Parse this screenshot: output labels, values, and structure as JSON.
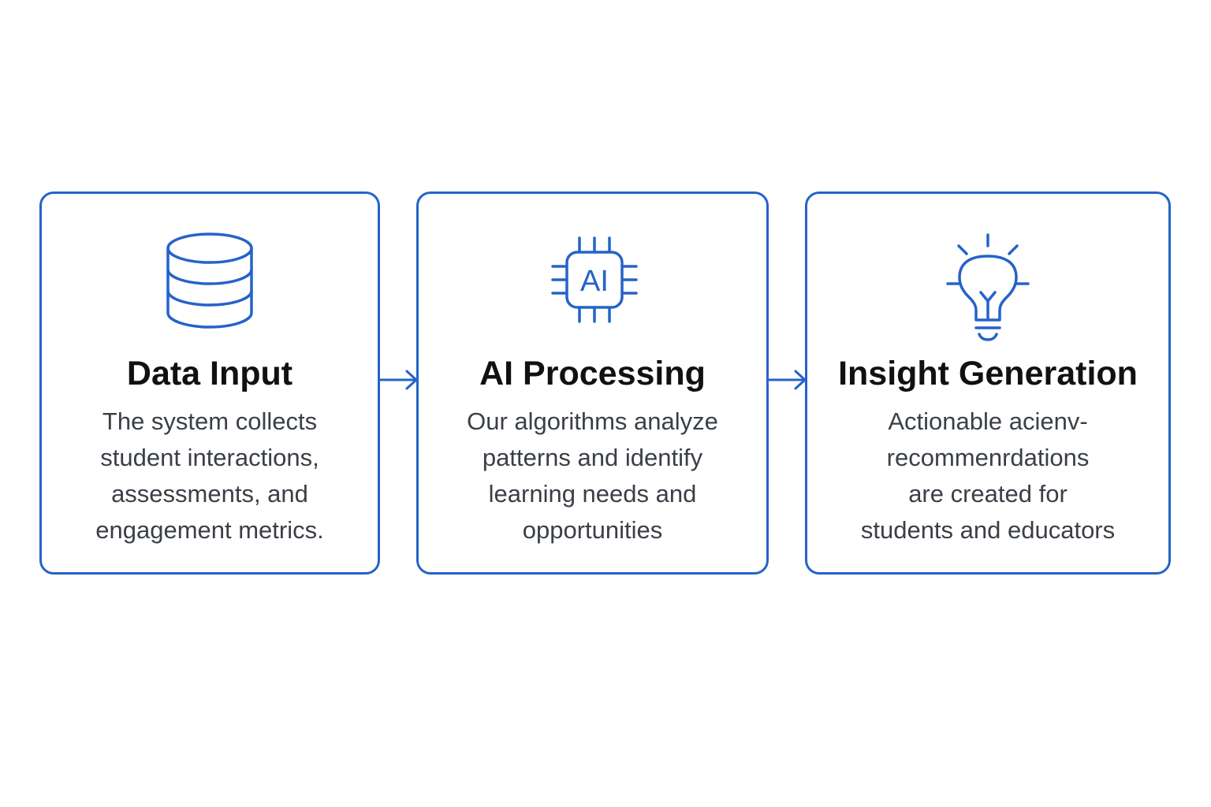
{
  "colors": {
    "accent": "#2563c9",
    "title": "#111111",
    "body_text": "#3a3f47",
    "background": "#ffffff"
  },
  "steps": [
    {
      "icon": "database-icon",
      "title": "Data Input",
      "description": [
        "The system collects",
        "student interactions,",
        "assessments, and",
        "engagement metrics."
      ]
    },
    {
      "icon": "ai-chip-icon",
      "icon_text": "AI",
      "title": "AI Processing",
      "description": [
        "Our algorithms analyze",
        "patterns and identify",
        "learning needs and",
        "opportunities"
      ]
    },
    {
      "icon": "lightbulb-icon",
      "title": "Insight Generation",
      "description": [
        "Actionable acienv-",
        "recommenrdations",
        "are created for",
        "students and educators"
      ]
    }
  ],
  "connectors": [
    "arrow-right-icon",
    "arrow-right-icon"
  ]
}
